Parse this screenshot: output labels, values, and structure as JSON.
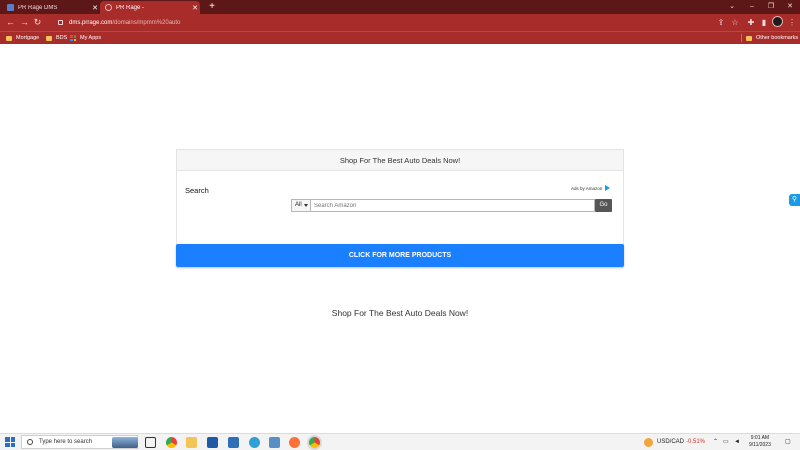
{
  "browser": {
    "tabs": [
      {
        "title": "PR Rage DMS",
        "active": false
      },
      {
        "title": "PR Rage -",
        "active": true
      }
    ],
    "address": {
      "host": "dms.prrage.com",
      "path": "/domains/mpmm%20auto"
    },
    "bookmarks": [
      {
        "label": "Mortgage",
        "icon": "folder-icon"
      },
      {
        "label": "BDS",
        "icon": "folder-icon"
      },
      {
        "label": "My Apps",
        "icon": "apps-grid-icon"
      }
    ],
    "other_bookmarks": "Other bookmarks"
  },
  "widget": {
    "header": "Shop For The Best Auto Deals Now!",
    "search_label": "Search",
    "ads_by": "Ads by Amazon",
    "category": "All",
    "search_placeholder": "Search Amazon",
    "go_label": "Go"
  },
  "cta": {
    "label": "CLICK FOR MORE PRODUCTS",
    "color": "#1a80ff"
  },
  "tagline": "Shop For The Best Auto Deals Now!",
  "taskbar": {
    "search_placeholder": "Type here to search",
    "ticker": {
      "symbol": "USD/CAD",
      "change": "-0.51%",
      "change_color": "#d0342c"
    },
    "time": "9:01 AM",
    "date": "9/11/2023"
  },
  "colors": {
    "chrome_dark": "#5c1716",
    "chrome": "#a82c29"
  }
}
